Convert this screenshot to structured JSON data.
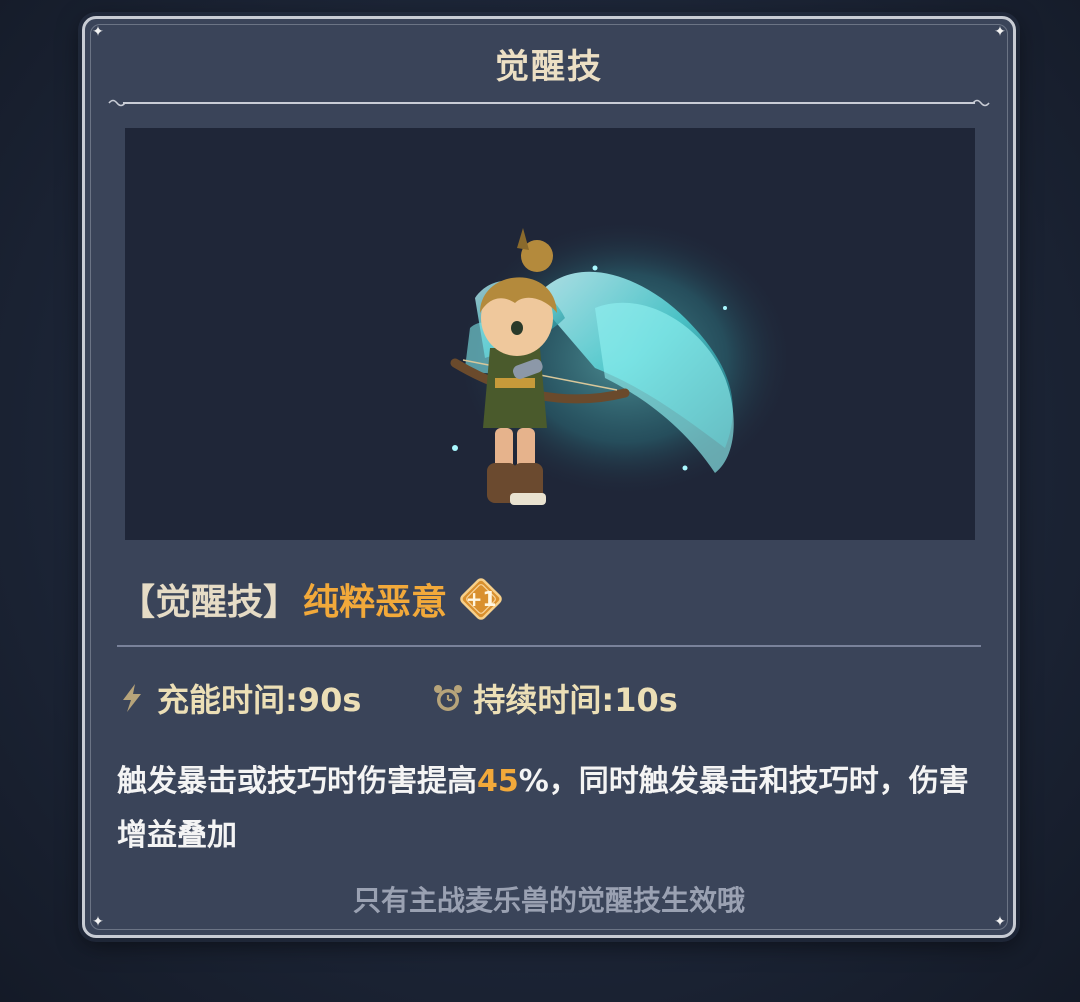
{
  "panel": {
    "title": "觉醒技"
  },
  "skill": {
    "bracket_label": "【觉醒技】",
    "name": "纯粹恶意",
    "level_badge": "+1",
    "charge_icon": "lightning-icon",
    "charge_time": "充能时间:90s",
    "duration_icon": "alarm-clock-icon",
    "duration": "持续时间:10s",
    "description_before": "触发暴击或技巧时伤害提高",
    "description_highlight": "45",
    "description_after": "%，同时触发暴击和技巧时，伤害增益叠加"
  },
  "footer": {
    "note": "只有主战麦乐兽的觉醒技生效哦"
  },
  "colors": {
    "panel_bg": "#3a4459",
    "title_text": "#ecdfc4",
    "accent_orange": "#f2a93a",
    "stat_text": "#ecdfb6",
    "note_text": "#9aa1b2",
    "preview_bg": "#1f2638"
  }
}
